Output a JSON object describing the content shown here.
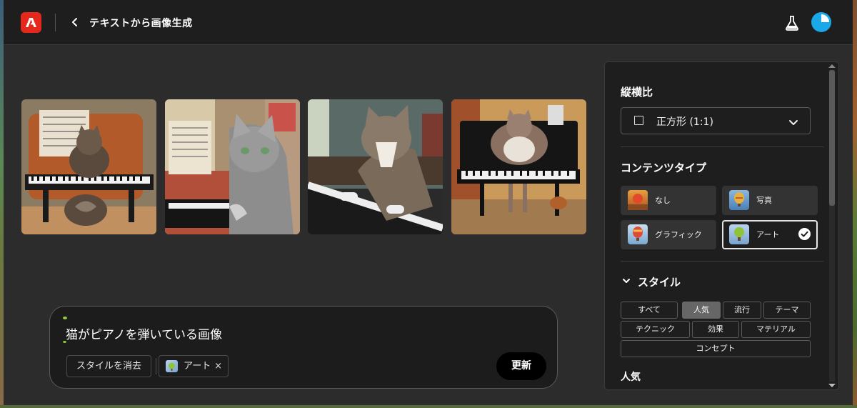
{
  "header": {
    "title": "テキストから画像生成"
  },
  "images": [
    {
      "name": "cat-piano-image-1"
    },
    {
      "name": "cat-piano-image-2"
    },
    {
      "name": "cat-piano-image-3"
    },
    {
      "name": "cat-piano-image-4"
    }
  ],
  "prompt": {
    "text": "猫がピアノを弾いている画像",
    "clear_style_label": "スタイルを消去",
    "style_chip_label": "アート",
    "style_chip_remove": "×",
    "update_label": "更新"
  },
  "panel": {
    "aspect_title": "縦横比",
    "aspect_value": "正方形 (1:1)",
    "content_type_title": "コンテンツタイプ",
    "content_types": [
      {
        "label": "なし",
        "selected": false
      },
      {
        "label": "写真",
        "selected": false
      },
      {
        "label": "グラフィック",
        "selected": false
      },
      {
        "label": "アート",
        "selected": true
      }
    ],
    "style_title": "スタイル",
    "style_tabs": [
      "すべて",
      "人気",
      "流行",
      "テーマ",
      "テクニック",
      "効果",
      "マテリアル",
      "コンセプト"
    ],
    "active_style_tab": "人気",
    "popular_title": "人気"
  },
  "colors": {
    "accent_brand": "#e4281b",
    "avatar": "#1ba8e8",
    "selection_check": "#8fcf3a"
  }
}
